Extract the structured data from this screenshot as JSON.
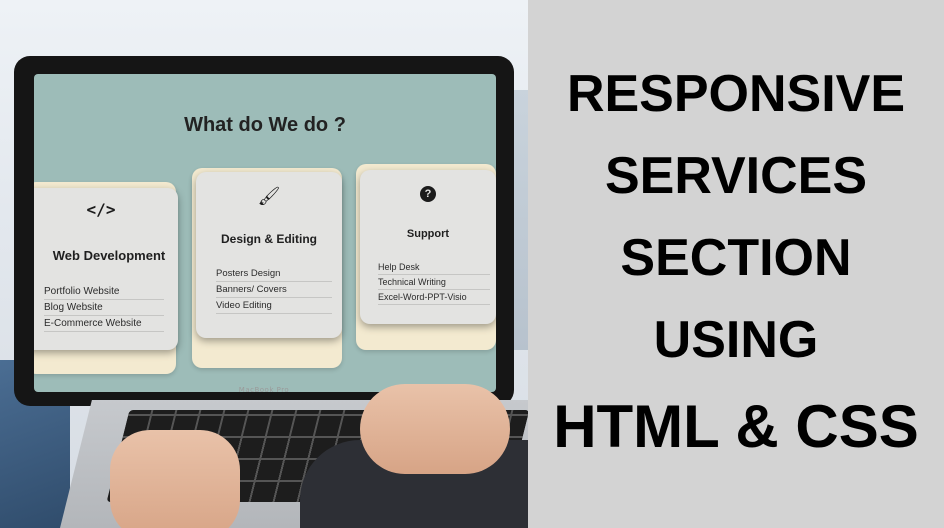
{
  "laptop": {
    "brand_label": "MacBook Pro",
    "screen": {
      "section_title": "What do We do ?",
      "cards": [
        {
          "icon": "code-icon",
          "icon_glyph": "</>",
          "title": "Web Development",
          "items": [
            "Portfolio Website",
            "Blog Website",
            "E-Commerce Website"
          ]
        },
        {
          "icon": "paintbrush-icon",
          "icon_glyph": "🖌",
          "title": "Design & Editing",
          "items": [
            "Posters Design",
            "Banners/ Covers",
            "Video Editing"
          ]
        },
        {
          "icon": "question-circle-icon",
          "icon_glyph": "?",
          "title": "Support",
          "items": [
            "Help Desk",
            "Technical Writing",
            "Excel-Word-PPT-Visio"
          ]
        }
      ]
    }
  },
  "headline": {
    "lines": [
      "RESPONSIVE",
      "SERVICES",
      "SECTION",
      "USING",
      "HTML & CSS"
    ]
  },
  "colors": {
    "screen_bg": "#9dbcb8",
    "card_bg": "#e3e3e1",
    "card_back": "#f3ead0",
    "panel_bg": "#d3d3d3",
    "headline_text": "#000000"
  }
}
